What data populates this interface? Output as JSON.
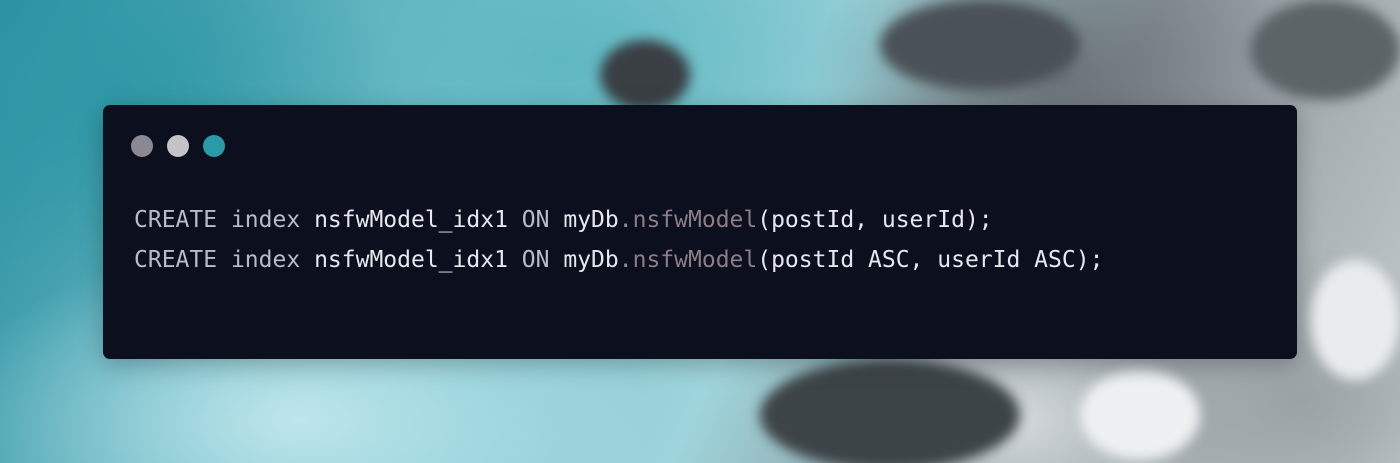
{
  "window": {
    "controls": [
      {
        "name": "close",
        "color": "#8b8893"
      },
      {
        "name": "minimize",
        "color": "#c4c4c8"
      },
      {
        "name": "maximize",
        "color": "#2a9aa9"
      }
    ]
  },
  "code": {
    "lines": [
      {
        "tokens": [
          {
            "text": "CREATE",
            "kind": "kw"
          },
          {
            "text": " ",
            "kind": "ws"
          },
          {
            "text": "index",
            "kind": "kw"
          },
          {
            "text": " ",
            "kind": "ws"
          },
          {
            "text": "nsfwModel_idx1",
            "kind": "id"
          },
          {
            "text": " ",
            "kind": "ws"
          },
          {
            "text": "ON",
            "kind": "kw"
          },
          {
            "text": " ",
            "kind": "ws"
          },
          {
            "text": "myDb",
            "kind": "id"
          },
          {
            "text": ".",
            "kind": "punct"
          },
          {
            "text": "nsfwModel",
            "kind": "member"
          },
          {
            "text": "(postId, userId);",
            "kind": "id"
          }
        ]
      },
      {
        "tokens": [
          {
            "text": "CREATE",
            "kind": "kw"
          },
          {
            "text": " ",
            "kind": "ws"
          },
          {
            "text": "index",
            "kind": "kw"
          },
          {
            "text": " ",
            "kind": "ws"
          },
          {
            "text": "nsfwModel_idx1",
            "kind": "id"
          },
          {
            "text": " ",
            "kind": "ws"
          },
          {
            "text": "ON",
            "kind": "kw"
          },
          {
            "text": " ",
            "kind": "ws"
          },
          {
            "text": "myDb",
            "kind": "id"
          },
          {
            "text": ".",
            "kind": "punct"
          },
          {
            "text": "nsfwModel",
            "kind": "member"
          },
          {
            "text": "(postId ASC, userId ASC);",
            "kind": "id"
          }
        ]
      }
    ]
  }
}
